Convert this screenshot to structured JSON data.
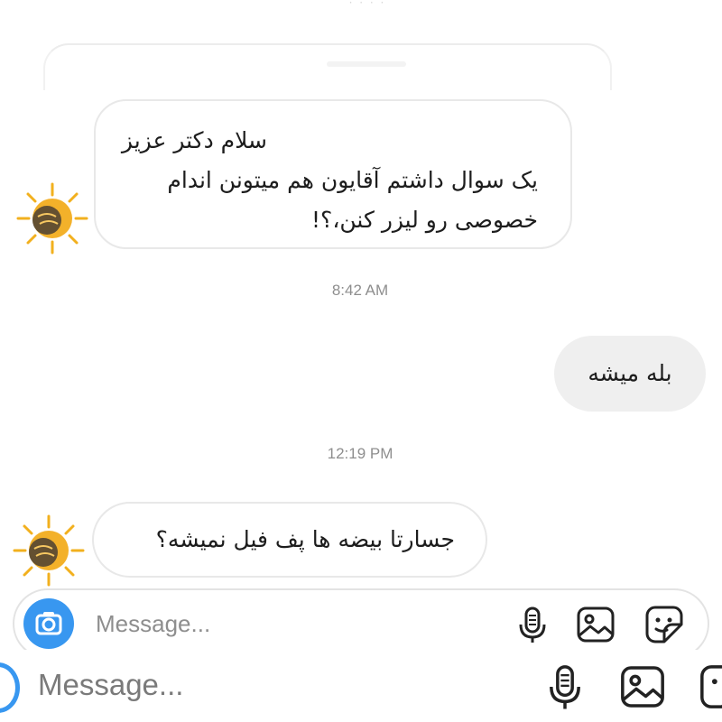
{
  "conversation": {
    "messages": [
      {
        "direction": "incoming",
        "lines": [
          "سلام دکتر عزیز",
          "یک سوال داشتم آقایون هم میتونن اندام",
          "خصوصی رو لیزر کنن،؟!"
        ]
      },
      {
        "timestamp": "8:42 AM"
      },
      {
        "direction": "outgoing",
        "text": "بله میشه"
      },
      {
        "timestamp": "12:19 PM"
      },
      {
        "direction": "incoming",
        "text": "جسارتا بیضه ها پف فیل نمیشه؟"
      }
    ]
  },
  "composer": {
    "placeholder": "Message...",
    "accent_color": "#3897f0",
    "icons": [
      "camera-icon",
      "microphone-icon",
      "gallery-icon",
      "sticker-icon"
    ]
  },
  "duplicate_composer": {
    "placeholder": "Message...",
    "icons": [
      "camera-icon",
      "microphone-icon",
      "gallery-icon",
      "sticker-icon"
    ]
  }
}
